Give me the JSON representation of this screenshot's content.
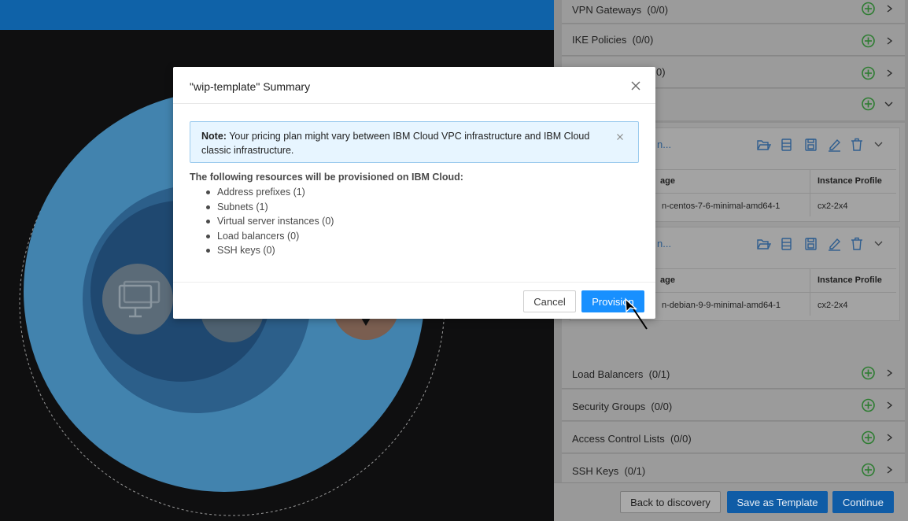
{
  "panel": {
    "rows_top": [
      {
        "label": "VPN Gateways  (0/0)"
      },
      {
        "label": "IKE Policies  (0/0)"
      },
      {
        "label": "0)"
      }
    ],
    "instances": [
      {
        "name": "n...",
        "col1_header": "age",
        "col2_header": "Instance Profile",
        "image": "n-centos-7-6-minimal-amd64-1",
        "profile": "cx2-2x4"
      },
      {
        "name": "n...",
        "col1_header": "age",
        "col2_header": "Instance Profile",
        "image": "n-debian-9-9-minimal-amd64-1",
        "profile": "cx2-2x4"
      }
    ],
    "rows_bottom": [
      {
        "label": "Load Balancers  (0/1)"
      },
      {
        "label": "Security Groups  (0/0)"
      },
      {
        "label": "Access Control Lists  (0/0)"
      },
      {
        "label": "SSH Keys  (0/1)"
      }
    ],
    "footer": {
      "back_label": "Back to discovery",
      "save_label": "Save as Template",
      "continue_label": "Continue"
    }
  },
  "modal": {
    "title": "\"wip-template\" Summary",
    "note_bold": "Note:",
    "note_text": "Your pricing plan might vary between IBM Cloud VPC infrastructure and IBM Cloud classic infrastructure.",
    "resources_heading": "The following resources will be provisioned on IBM Cloud:",
    "resources": [
      "Address prefixes (1)",
      "Subnets (1)",
      "Virtual server instances (0)",
      "Load balancers (0)",
      "SSH keys (0)"
    ],
    "cancel_label": "Cancel",
    "provision_label": "Provision"
  },
  "colors": {
    "primary": "#1890ff",
    "topbar": "#0f62a8",
    "add_icon": "#2e7d32",
    "note_bg": "#e7f5ff"
  },
  "icons": [
    "plus-circle-icon",
    "chevron-right-icon",
    "chevron-down-icon",
    "folder-open-icon",
    "server-icon",
    "save-icon",
    "edit-icon",
    "trash-icon",
    "close-icon",
    "monitor-icon",
    "mouse-cursor-icon"
  ]
}
